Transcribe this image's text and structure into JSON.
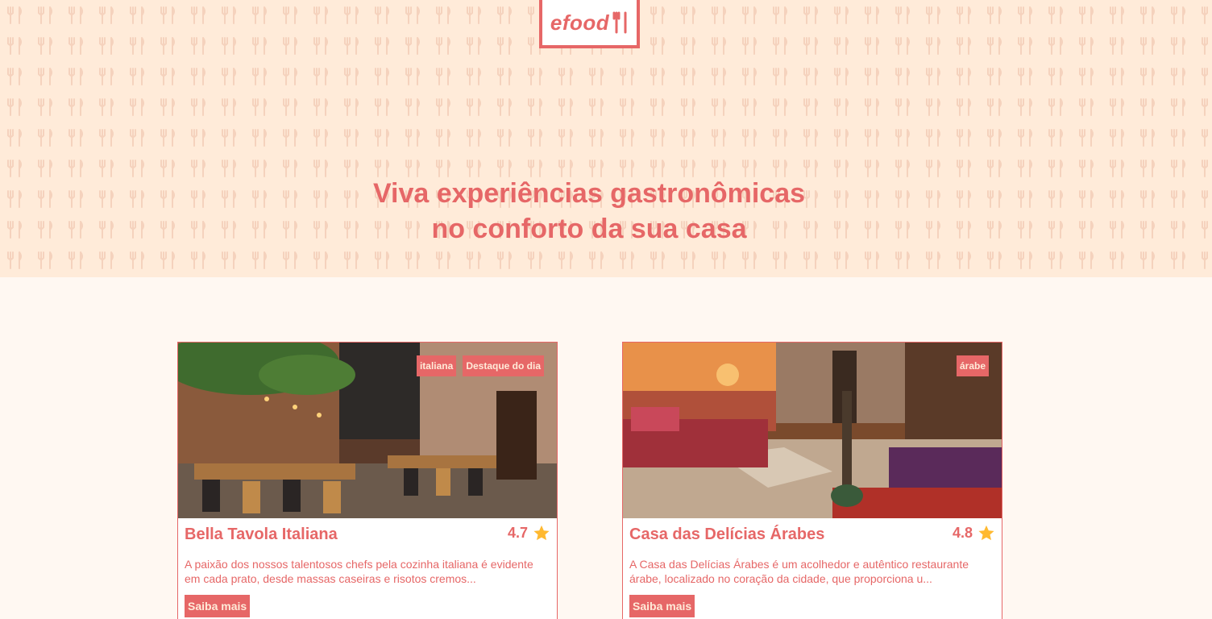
{
  "brand": {
    "logo_text": "efood"
  },
  "hero": {
    "title_line1": "Viva experiências gastronômicas",
    "title_line2": "no conforto da sua casa"
  },
  "colors": {
    "accent": "#e66767",
    "hero_bg": "#ffebd9",
    "page_bg": "#fff8f2",
    "star": "#ffb930"
  },
  "restaurants": [
    {
      "name": "Bella Tavola Italiana",
      "rating": "4.7",
      "tags": [
        "italiana",
        "Destaque do dia"
      ],
      "description": "A paixão dos nossos talentosos chefs pela cozinha italiana é evidente em cada prato, desde massas caseiras e risotos cremos...",
      "button_label": "Saiba mais",
      "rating_icon": "star-icon"
    },
    {
      "name": "Casa das Delícias Árabes",
      "rating": "4.8",
      "tags": [
        "árabe"
      ],
      "description": "A Casa das Delícias Árabes é um acolhedor e autêntico restaurante árabe, localizado no coração da cidade, que proporciona u...",
      "button_label": "Saiba mais",
      "rating_icon": "star-icon"
    }
  ]
}
